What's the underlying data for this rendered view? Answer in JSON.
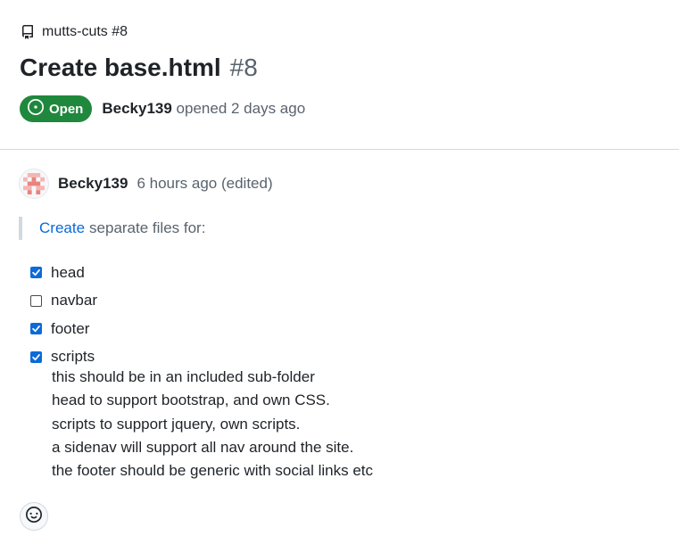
{
  "repo": {
    "icon": "repo-icon",
    "label": "mutts-cuts #8"
  },
  "issue": {
    "title": "Create base.html",
    "number": "#8",
    "state": "Open",
    "author": "Becky139",
    "opened_text": "opened 2 days ago"
  },
  "comment": {
    "author": "Becky139",
    "time": "6 hours ago (edited)",
    "quote_link": "Create",
    "quote_text": "separate files for:",
    "tasks": [
      {
        "label": "head",
        "checked": true
      },
      {
        "label": "navbar",
        "checked": false
      },
      {
        "label": "footer",
        "checked": true
      },
      {
        "label": "scripts",
        "checked": true
      }
    ],
    "notes": [
      "this should be in an included sub-folder",
      "head to support bootstrap, and own CSS.",
      "scripts to support jquery, own scripts.",
      "a sidenav will support all nav around the site.",
      "the footer should be generic with social links etc"
    ]
  },
  "colors": {
    "open_badge": "#1f883d",
    "link": "#0969da",
    "checkbox": "#0b6bd8"
  },
  "reaction_button": {
    "icon": "smiley-icon"
  }
}
